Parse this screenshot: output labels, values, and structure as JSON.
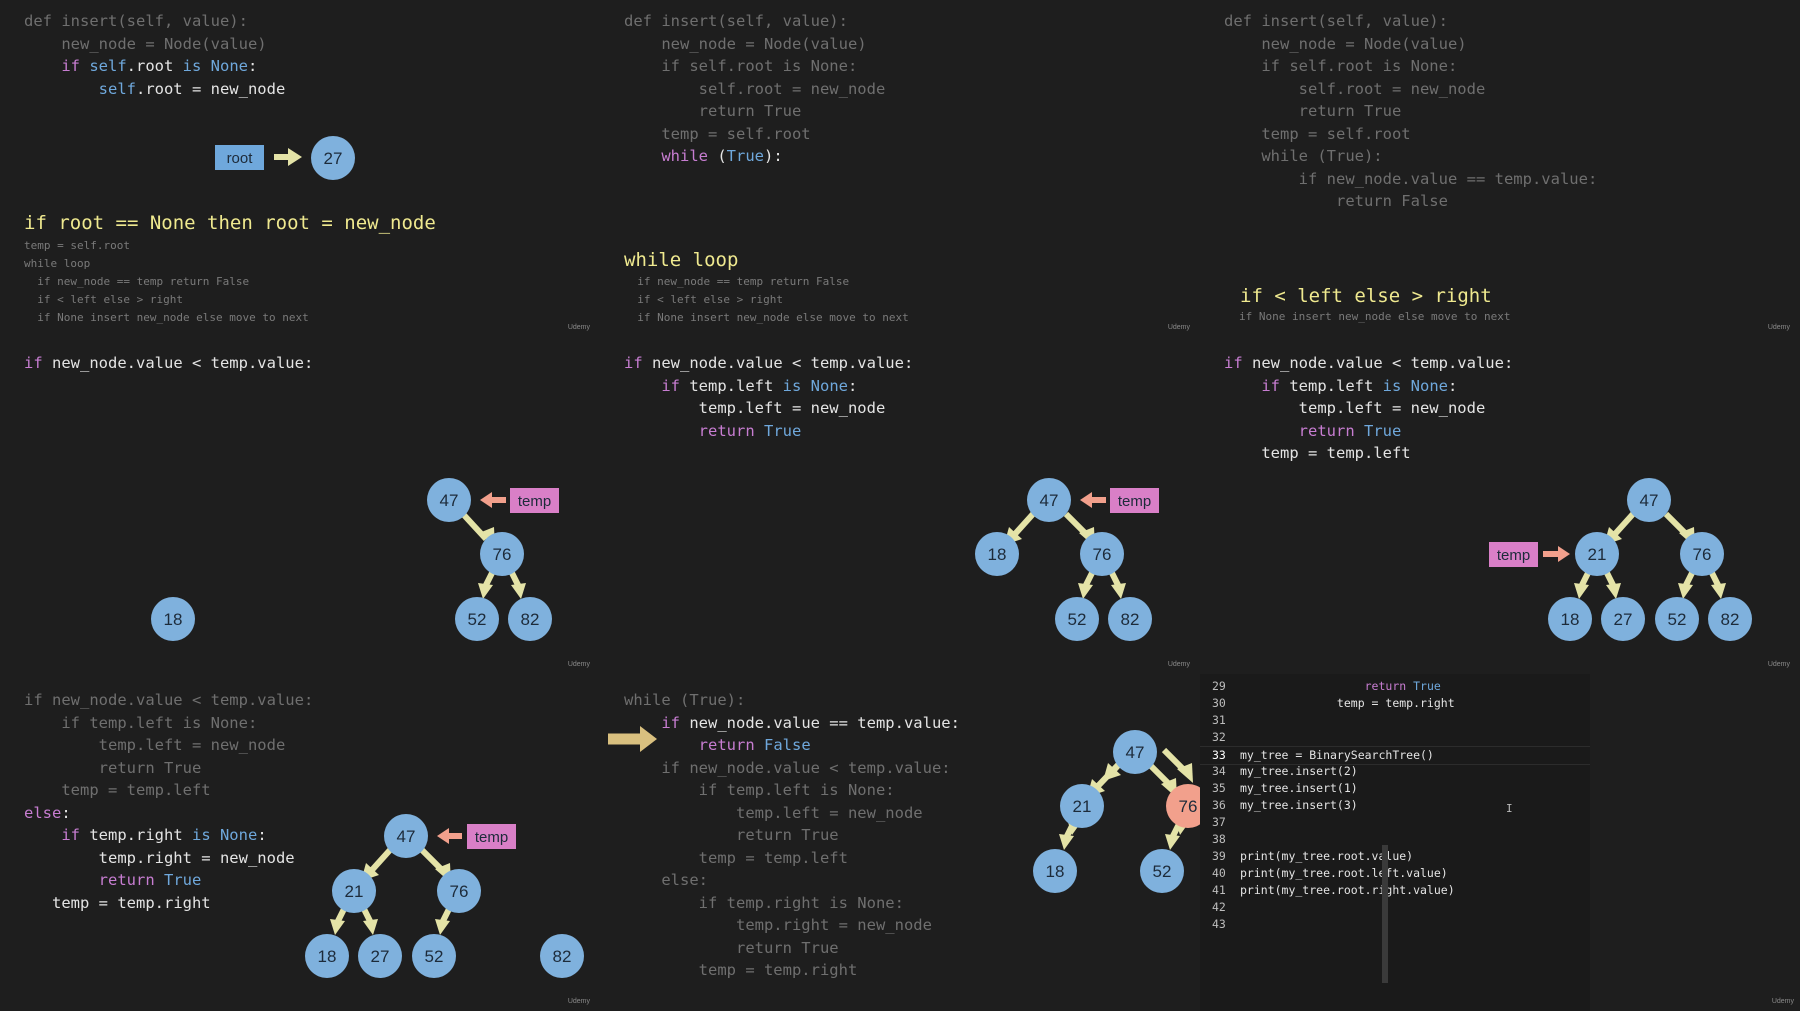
{
  "watermark": "Udemy",
  "colors": {
    "node_fill": "#7fb1dd",
    "node_highlight": "#f2a08c",
    "tag_temp": "#d97fc7",
    "tag_root": "#6fa8dc",
    "arrow": "#e4e3a7",
    "tag_arrow": "#f2a08c"
  },
  "panels": [
    {
      "code": [
        "def insert(self, value):",
        "    new_node = Node(value)",
        "    if self.root is None:",
        "        self.root = new_node"
      ],
      "heading": "if root == None then root = new_node",
      "notes": [
        "temp = self.root",
        "while loop",
        "  if new_node == temp return False",
        "  if < left else > right",
        "  if None insert new_node else move to next"
      ],
      "root_tag": "root",
      "root_value": "27"
    },
    {
      "code": [
        "def insert(self, value):",
        "    new_node = Node(value)",
        "    if self.root is None:",
        "        self.root = new_node",
        "        return True",
        "    temp = self.root",
        "    while (True):"
      ],
      "heading": "while loop",
      "notes": [
        "  if new_node == temp return False",
        "  if < left else > right",
        "  if None insert new_node else move to next"
      ]
    },
    {
      "code": [
        "def insert(self, value):",
        "    new_node = Node(value)",
        "    if self.root is None:",
        "        self.root = new_node",
        "        return True",
        "    temp = self.root",
        "    while (True):",
        "        if new_node.value == temp.value:",
        "            return False"
      ],
      "heading": "if < left else > right",
      "notes": [
        "if None insert new_node else move to next"
      ]
    },
    {
      "code": [
        "if new_node.value < temp.value:"
      ],
      "nodes": {
        "n47": "47",
        "n76": "76",
        "n52": "52",
        "n82": "82",
        "n18": "18"
      },
      "tag": "temp"
    },
    {
      "code": [
        "if new_node.value < temp.value:",
        "    if temp.left is None:",
        "        temp.left = new_node",
        "        return True"
      ],
      "nodes": {
        "n47": "47",
        "n18": "18",
        "n76": "76",
        "n52": "52",
        "n82": "82"
      },
      "tag": "temp"
    },
    {
      "code": [
        "if new_node.value < temp.value:",
        "    if temp.left is None:",
        "        temp.left = new_node",
        "        return True",
        "    temp = temp.left"
      ],
      "nodes": {
        "n47": "47",
        "n21": "21",
        "n76": "76",
        "n18": "18",
        "n27": "27",
        "n52": "52",
        "n82": "82"
      },
      "tag": "temp"
    },
    {
      "code": [
        "if new_node.value < temp.value:",
        "    if temp.left is None:",
        "        temp.left = new_node",
        "        return True",
        "    temp = temp.left",
        "else:",
        "    if temp.right is None:",
        "        temp.right = new_node",
        "        return True",
        "   temp = temp.right"
      ],
      "nodes": {
        "n47": "47",
        "n21": "21",
        "n76": "76",
        "n18": "18",
        "n27": "27",
        "n52": "52",
        "n82": "82"
      },
      "tag": "temp"
    },
    {
      "code": [
        "while (True):",
        "    if new_node.value == temp.value:",
        "        return False",
        "    if new_node.value < temp.value:",
        "        if temp.left is None:",
        "            temp.left = new_node",
        "            return True",
        "        temp = temp.left",
        "    else:",
        "        if temp.right is None:",
        "            temp.right = new_node",
        "            return True",
        "        temp = temp.right"
      ],
      "nodes": {
        "n47": "47",
        "n21": "21",
        "n76": "76",
        "n18": "18",
        "n52": "52"
      }
    }
  ],
  "editor": {
    "lines": [
      {
        "num": "29",
        "text": "                  return True"
      },
      {
        "num": "30",
        "text": "              temp = temp.right"
      },
      {
        "num": "31",
        "text": ""
      },
      {
        "num": "32",
        "text": ""
      },
      {
        "num": "33",
        "text": "my_tree = BinarySearchTree()"
      },
      {
        "num": "34",
        "text": "my_tree.insert(2)"
      },
      {
        "num": "35",
        "text": "my_tree.insert(1)"
      },
      {
        "num": "36",
        "text": "my_tree.insert(3)"
      },
      {
        "num": "37",
        "text": ""
      },
      {
        "num": "38",
        "text": ""
      },
      {
        "num": "39",
        "text": "print(my_tree.root.value)"
      },
      {
        "num": "40",
        "text": "print(my_tree.root.left.value)"
      },
      {
        "num": "41",
        "text": "print(my_tree.root.right.value)"
      },
      {
        "num": "42",
        "text": ""
      },
      {
        "num": "43",
        "text": ""
      }
    ],
    "cursor_glyph": "I"
  }
}
